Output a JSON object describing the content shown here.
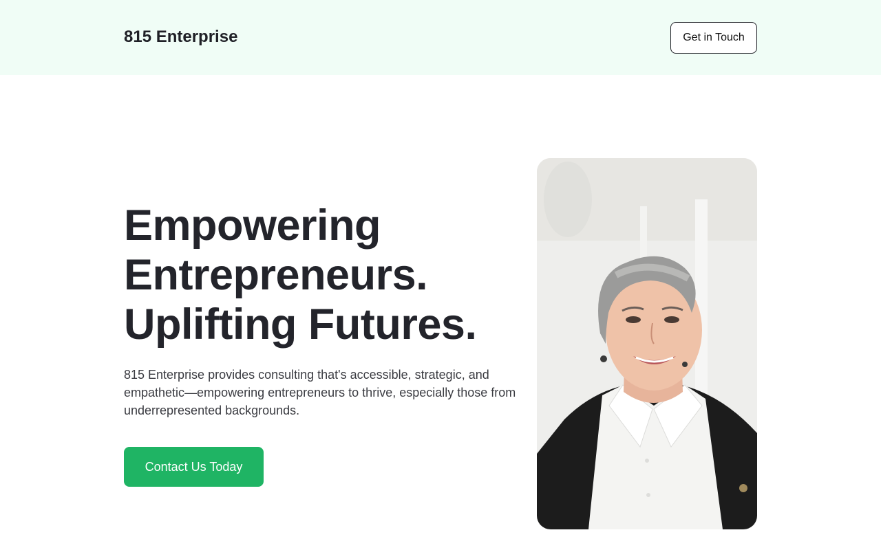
{
  "header": {
    "brand": "815 Enterprise",
    "cta_label": "Get in Touch"
  },
  "hero": {
    "title_lines": [
      "Empowering",
      "Entrepreneurs.",
      "Uplifting Futures."
    ],
    "description": "815 Enterprise provides consulting that's accessible, strategic, and empathetic—empowering entrepreneurs to thrive, especially those from underrepresented backgrounds.",
    "cta_label": "Contact Us Today"
  },
  "colors": {
    "header_bg": "#f0fdf6",
    "accent": "#1fb464",
    "text": "#1f2026"
  },
  "image": {
    "subject": "portrait of a smiling woman with short gray hair wearing a white shirt and black jacket"
  }
}
